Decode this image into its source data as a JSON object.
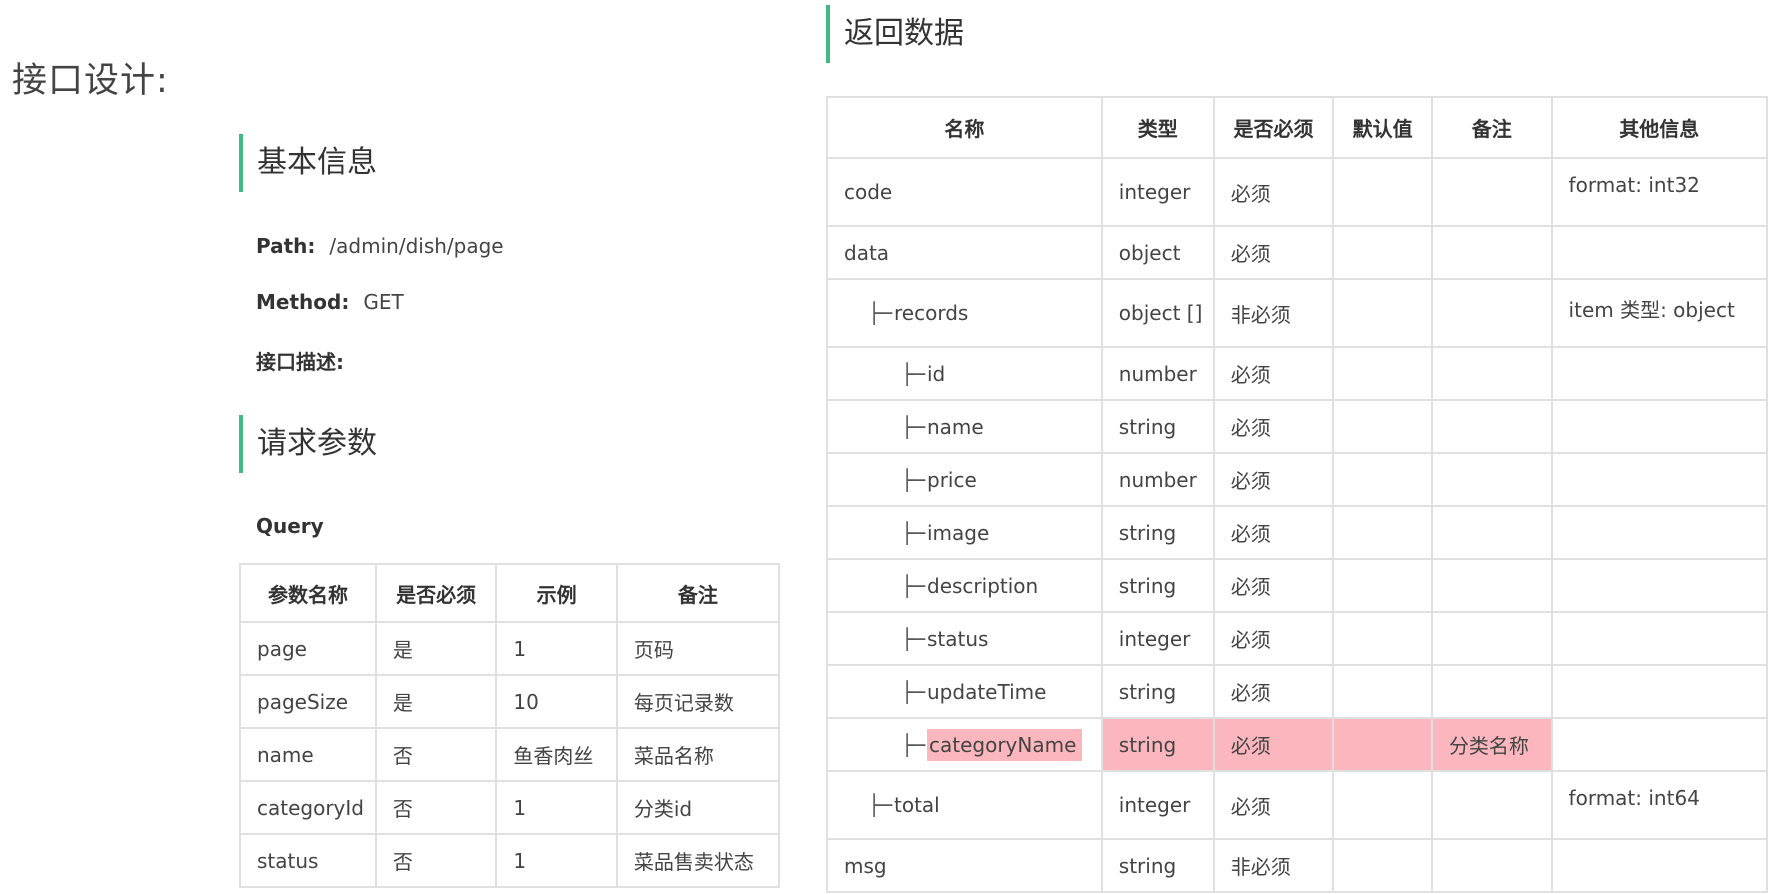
{
  "page_title": "接口设计:",
  "basic_info": {
    "heading": "基本信息",
    "path_label": "Path:",
    "path_value": "/admin/dish/page",
    "method_label": "Method:",
    "method_value": "GET",
    "desc_label": "接口描述:"
  },
  "request": {
    "heading": "请求参数",
    "query_label": "Query",
    "headers": [
      "参数名称",
      "是否必须",
      "示例",
      "备注"
    ],
    "rows": [
      [
        "page",
        "是",
        "1",
        "页码"
      ],
      [
        "pageSize",
        "是",
        "10",
        "每页记录数"
      ],
      [
        "name",
        "否",
        "鱼香肉丝",
        "菜品名称"
      ],
      [
        "categoryId",
        "否",
        "1",
        "分类id"
      ],
      [
        "status",
        "否",
        "1",
        "菜品售卖状态"
      ]
    ]
  },
  "response": {
    "heading": "返回数据",
    "headers": [
      "名称",
      "类型",
      "是否必须",
      "默认值",
      "备注",
      "其他信息"
    ],
    "branch_glyph": "├─",
    "rows": [
      {
        "name": "code",
        "type": "integer",
        "required": "必须",
        "default": "",
        "note": "",
        "other": "format: int32"
      },
      {
        "name": "data",
        "type": "object",
        "required": "必须",
        "default": "",
        "note": "",
        "other": ""
      },
      {
        "name": "records",
        "type": "object []",
        "required": "非必须",
        "default": "",
        "note": "",
        "other": "item 类型: object"
      },
      {
        "name": "id",
        "type": "number",
        "required": "必须",
        "default": "",
        "note": "",
        "other": ""
      },
      {
        "name": "name",
        "type": "string",
        "required": "必须",
        "default": "",
        "note": "",
        "other": ""
      },
      {
        "name": "price",
        "type": "number",
        "required": "必须",
        "default": "",
        "note": "",
        "other": ""
      },
      {
        "name": "image",
        "type": "string",
        "required": "必须",
        "default": "",
        "note": "",
        "other": ""
      },
      {
        "name": "description",
        "type": "string",
        "required": "必须",
        "default": "",
        "note": "",
        "other": ""
      },
      {
        "name": "status",
        "type": "integer",
        "required": "必须",
        "default": "",
        "note": "",
        "other": ""
      },
      {
        "name": "updateTime",
        "type": "string",
        "required": "必须",
        "default": "",
        "note": "",
        "other": ""
      },
      {
        "name": "categoryName",
        "type": "string",
        "required": "必须",
        "default": "",
        "note": "分类名称",
        "other": ""
      },
      {
        "name": "total",
        "type": "integer",
        "required": "必须",
        "default": "",
        "note": "",
        "other": "format: int64"
      },
      {
        "name": "msg",
        "type": "string",
        "required": "非必须",
        "default": "",
        "note": "",
        "other": ""
      }
    ]
  },
  "colors": {
    "accent": "#42b983",
    "highlight": "#fbb7bd",
    "border": "#e0e0e0"
  }
}
